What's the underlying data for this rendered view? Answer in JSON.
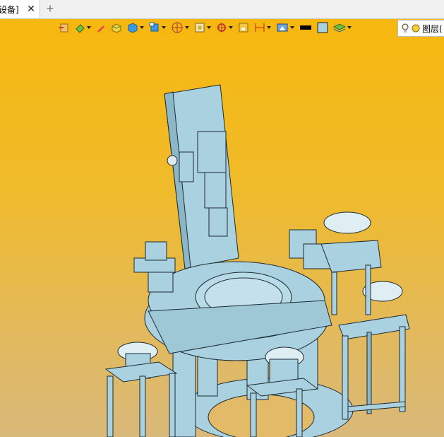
{
  "tab": {
    "label": "设备]",
    "close_glyph": "✕",
    "add_glyph": "+"
  },
  "toolbar": {
    "icons": [
      "exit-sketch-icon",
      "paint-bucket-icon",
      "pencil-icon",
      "box-face-icon",
      "cube-view-icon",
      "view-orientation-icon",
      "sphere-grid-icon",
      "render-style-icon",
      "axis-origin-icon",
      "section-box-icon",
      "dimension-icon",
      "display-filter-icon",
      "black-color-swatch",
      "light-blue-color-swatch",
      "layers-stack-icon"
    ]
  },
  "layer_control": {
    "label": "图层("
  },
  "colors": {
    "model_fill": "#a9d1df",
    "model_line": "#1d2b33",
    "background_top": "#f6b80e",
    "background_bottom": "#d9b97a"
  }
}
